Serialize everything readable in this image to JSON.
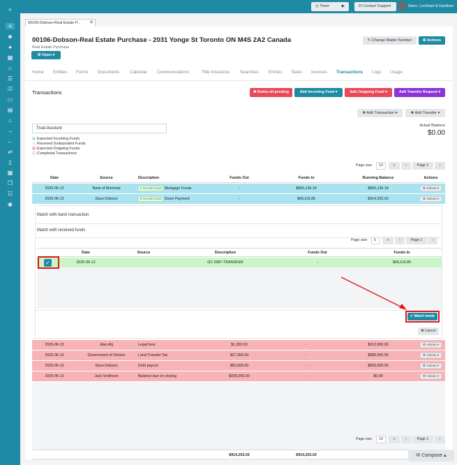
{
  "tab": {
    "label": "00106-Dobson-Real Estate P..."
  },
  "topbar": {
    "timer_label": "Timer",
    "contact_label": "Contact Support",
    "user_name": "Stern, Lockhart & Gardiner"
  },
  "matter": {
    "title": "00106-Dobson-Real Estate Purchase - 2031 Yonge St Toronto ON M4S 2A2 Canada",
    "subtitle": "Real Estate Purchase",
    "open_label": "Open",
    "change_number_label": "Change Matter Number",
    "actions_label": "Actions"
  },
  "nav": [
    "Home",
    "Entities",
    "Forms",
    "Documents",
    "Calendar",
    "Communications",
    "Title Insurance",
    "Searches",
    "Entries",
    "Tasks",
    "Invoices",
    "Transactions",
    "Logs",
    "Usage"
  ],
  "nav_active": "Transactions",
  "transactions": {
    "title": "Transactions",
    "delete_all_label": "Delete all pending",
    "add_incoming_label": "Add Incoming Fund",
    "add_outgoing_label": "Add Outgoing Fund",
    "add_transfer_request_label": "Add Transfer Request",
    "add_transaction_label": "Add Transaction",
    "add_transfer_label": "Add Transfer",
    "trust_account": "Trust Account",
    "actual_balance_label": "Actual Balance",
    "actual_balance_value": "$0.00",
    "legend": [
      {
        "label": "Expected Incoming Funds",
        "color": "#a9e3ef"
      },
      {
        "label": "Received Undeposited Funds",
        "color": "#e9f6c8"
      },
      {
        "label": "Expected Outgoing Funds",
        "color": "#f7b3b5"
      },
      {
        "label": "Completed Transactions",
        "color": "#ffffff"
      }
    ],
    "page_size_label": "Page size",
    "page_size_value": "10",
    "page_label": "Page 1",
    "columns": [
      "Date",
      "Source",
      "Description",
      "Funds Out",
      "Funds In",
      "Running Balance",
      "Actions"
    ],
    "incoming_rows": [
      {
        "date": "2025-06-13",
        "source": "Bank of Montreal",
        "badge": "5 records found",
        "description": "Mortgage Funds",
        "funds_out": "-",
        "funds_in": "$865,136.18",
        "balance": "$865,136.18",
        "actions": "Actions"
      },
      {
        "date": "2025-06-13",
        "source": "Dave Dobson",
        "badge": "5 records found",
        "description": "Down Payment",
        "funds_out": "-",
        "funds_in": "$49,116.85",
        "balance": "$914,253.03",
        "actions": "Actions"
      }
    ],
    "outgoing_rows": [
      {
        "date": "2025-06-13",
        "source": "Alan Alij",
        "description": "Legal fees",
        "funds_out": "$1,303.03",
        "funds_in": "-",
        "balance": "$912,950.00",
        "actions": "Actions"
      },
      {
        "date": "2025-06-13",
        "source": "Government of Ontario",
        "description": "Land Transfer Tax",
        "funds_out": "$27,950.00",
        "funds_in": "-",
        "balance": "$885,000.00",
        "actions": "Actions"
      },
      {
        "date": "2025-06-13",
        "source": "Dave Dobson",
        "description": "Debt payout",
        "funds_out": "$50,000.00",
        "funds_in": "-",
        "balance": "$835,000.00",
        "actions": "Actions"
      },
      {
        "date": "2025-06-13",
        "source": "Jack Smithson",
        "description": "Balance due on closing",
        "funds_out": "$835,000.00",
        "funds_in": "-",
        "balance": "$0.00",
        "actions": "Actions"
      }
    ],
    "totals": {
      "funds_out": "$914,253.03",
      "funds_in": "$914,253.03"
    }
  },
  "match": {
    "bank_title": "Match with bank transaction",
    "received_title": "Match with received funds",
    "page_size_label": "Page size",
    "page_size_value": "5",
    "page_label": "Page 1",
    "columns": [
      "Date",
      "Source",
      "Description",
      "Funds Out",
      "Funds In"
    ],
    "row": {
      "date": "2025-06-13",
      "source": "",
      "description": "GC 0087-TRANSFER",
      "funds_out": "-",
      "funds_in": "$49,116.85",
      "checked": true
    },
    "match_button": "Match funds",
    "cancel_button": "Cancel"
  },
  "compose_label": "Compose"
}
